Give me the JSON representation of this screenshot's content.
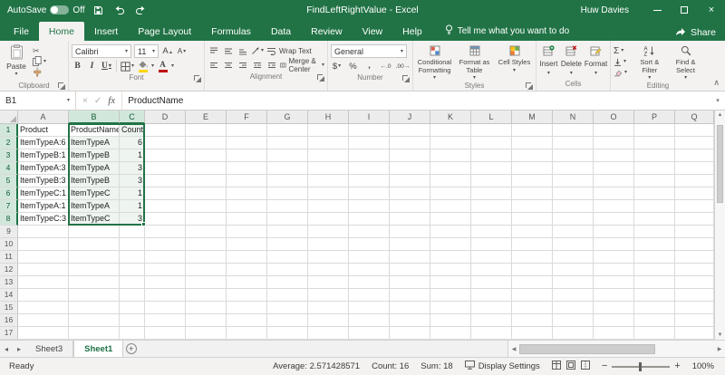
{
  "titlebar": {
    "autosave_label": "AutoSave",
    "autosave_state": "Off",
    "title": "FindLeftRightValue - Excel",
    "user": "Huw Davies"
  },
  "tabs": [
    {
      "label": "File",
      "file": true
    },
    {
      "label": "Home",
      "active": true
    },
    {
      "label": "Insert"
    },
    {
      "label": "Page Layout"
    },
    {
      "label": "Formulas"
    },
    {
      "label": "Data"
    },
    {
      "label": "Review"
    },
    {
      "label": "View"
    },
    {
      "label": "Help"
    }
  ],
  "tell_me": "Tell me what you want to do",
  "share_label": "Share",
  "ribbon": {
    "clipboard": {
      "label": "Clipboard",
      "paste": "Paste"
    },
    "font": {
      "label": "Font",
      "name": "Calibri",
      "size": "11"
    },
    "alignment": {
      "label": "Alignment",
      "wrap": "Wrap Text",
      "merge": "Merge & Center"
    },
    "number": {
      "label": "Number",
      "format": "General"
    },
    "styles": {
      "label": "Styles",
      "conditional": "Conditional Formatting",
      "table": "Format as Table",
      "cell_styles": "Cell Styles"
    },
    "cells": {
      "label": "Cells",
      "insert": "Insert",
      "delete": "Delete",
      "format": "Format"
    },
    "editing": {
      "label": "Editing",
      "autosum": "Σ",
      "sort": "Sort & Filter",
      "find": "Find & Select"
    }
  },
  "formula_bar": {
    "name_box": "B1",
    "formula": "ProductName"
  },
  "grid": {
    "columns": [
      "A",
      "B",
      "C",
      "D",
      "E",
      "F",
      "G",
      "H",
      "I",
      "J",
      "K",
      "L",
      "M",
      "N",
      "O",
      "P",
      "Q"
    ],
    "row_count": 17,
    "selected_columns": [
      "B",
      "C"
    ],
    "selected_rows": [
      1,
      2,
      3,
      4,
      5,
      6,
      7,
      8
    ],
    "active_cell": "B1",
    "cells": [
      [
        "Product",
        "ProductName",
        "Count"
      ],
      [
        "ItemTypeA:6",
        "ItemTypeA",
        "6"
      ],
      [
        "ItemTypeB:1",
        "ItemTypeB",
        "1"
      ],
      [
        "ItemTypeA:3",
        "ItemTypeA",
        "3"
      ],
      [
        "ItemTypeB:3",
        "ItemTypeB",
        "3"
      ],
      [
        "ItemTypeC:1",
        "ItemTypeC",
        "1"
      ],
      [
        "ItemTypeA:1",
        "ItemTypeA",
        "1"
      ],
      [
        "ItemTypeC:3",
        "ItemTypeC",
        "3"
      ]
    ]
  },
  "sheet_tabs": [
    {
      "label": "Sheet3",
      "active": false
    },
    {
      "label": "Sheet1",
      "active": true
    }
  ],
  "status_bar": {
    "mode": "Ready",
    "average": "Average: 2.571428571",
    "count": "Count: 16",
    "sum": "Sum: 18",
    "display_settings": "Display Settings",
    "zoom": "100%"
  },
  "colors": {
    "excel_green": "#217346",
    "selection_border": "#217346"
  }
}
